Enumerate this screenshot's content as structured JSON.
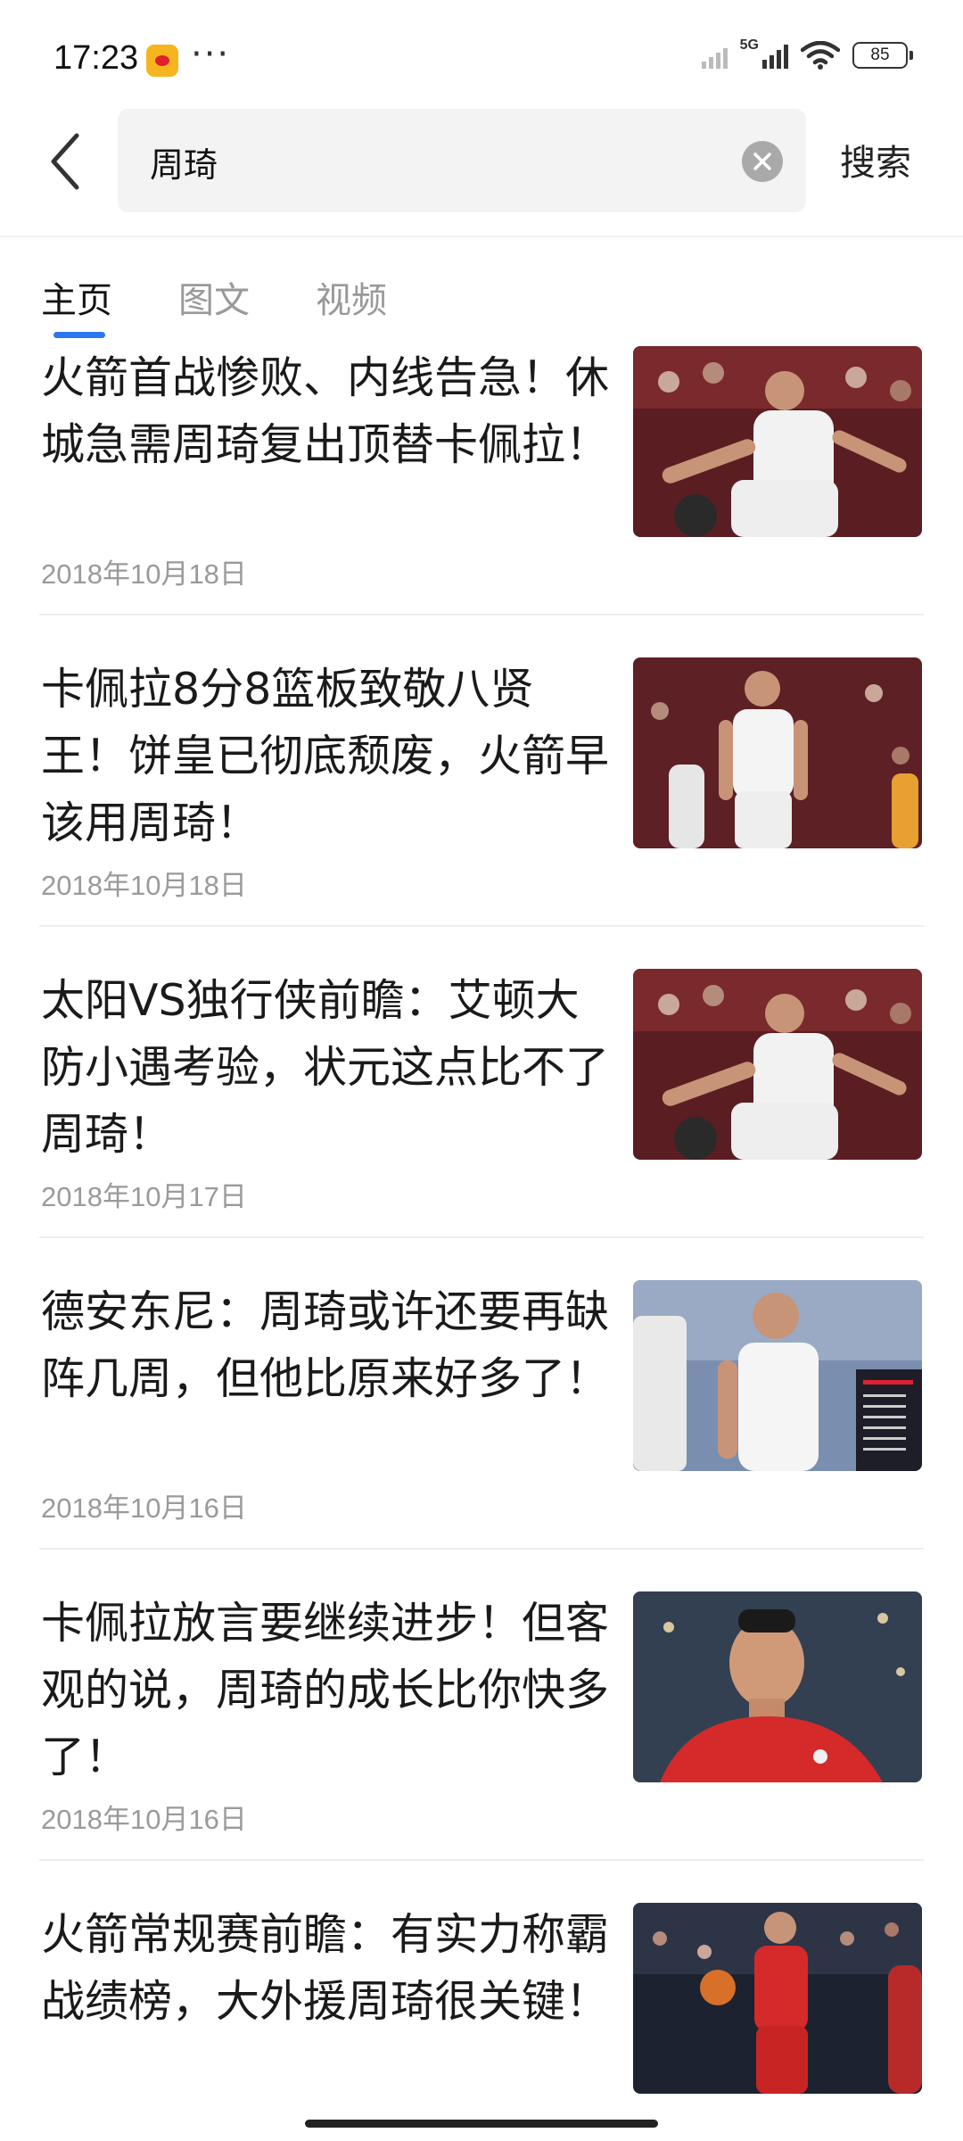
{
  "status_bar": {
    "time": "17:23",
    "more": "···",
    "network": "5G",
    "battery": "85",
    "app_icon": "weibo-icon"
  },
  "header": {
    "search_value": "周琦",
    "search_button": "搜索",
    "back_icon": "back-arrow-icon",
    "clear_icon": "clear-icon"
  },
  "tabs": [
    {
      "label": "主页",
      "active": true
    },
    {
      "label": "图文",
      "active": false
    },
    {
      "label": "视频",
      "active": false
    }
  ],
  "articles": [
    {
      "title": "火箭首战惨败、内线告急！休城急需周琦复出顶替卡佩拉！",
      "date": "2018年10月18日",
      "thumb": "basketball-player-dribble"
    },
    {
      "title": "卡佩拉8分8篮板致敬八贤王！饼皇已彻底颓废，火箭早该用周琦！",
      "date": "2018年10月18日",
      "thumb": "basketball-player-standing"
    },
    {
      "title": "太阳VS独行侠前瞻：艾顿大防小遇考验，状元这点比不了周琦！",
      "date": "2018年10月17日",
      "thumb": "basketball-player-dribble"
    },
    {
      "title": "德安东尼：周琦或许还要再缺阵几周，但他比原来好多了！",
      "date": "2018年10月16日",
      "thumb": "basketball-player-broadcast"
    },
    {
      "title": "卡佩拉放言要继续进步！但客观的说，周琦的成长比你快多了！",
      "date": "2018年10月16日",
      "thumb": "basketball-player-portrait"
    },
    {
      "title": "火箭常规赛前瞻：有实力称霸战绩榜，大外援周琦很关键！",
      "date": "",
      "thumb": "basketball-player-red-jersey"
    }
  ]
}
